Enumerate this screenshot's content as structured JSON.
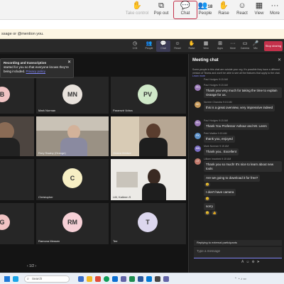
{
  "top_toolbar": {
    "items": [
      {
        "label": "Take control",
        "icon": "hand-icon"
      },
      {
        "label": "Pop out",
        "icon": "popout-icon"
      },
      {
        "label": "Chat",
        "icon": "chat-icon"
      },
      {
        "label": "People",
        "icon": "people-icon",
        "count": "18"
      },
      {
        "label": "Raise",
        "icon": "raise-hand-icon"
      },
      {
        "label": "React",
        "icon": "react-icon"
      },
      {
        "label": "View",
        "icon": "view-icon"
      },
      {
        "label": "More",
        "icon": "more-icon"
      }
    ]
  },
  "banner": {
    "text": "ssage or @mention you."
  },
  "meeting_toolbar": {
    "items": [
      {
        "label": "1:04"
      },
      {
        "label": "People",
        "count": "18"
      },
      {
        "label": "Chat"
      },
      {
        "label": "React"
      },
      {
        "label": "Raise"
      },
      {
        "label": "View"
      },
      {
        "label": "Apps"
      },
      {
        "label": "More"
      },
      {
        "label": "Camera"
      },
      {
        "label": "Mic"
      },
      {
        "label": "Share"
      }
    ],
    "leave_label": "Stop sharing"
  },
  "recording_toast": {
    "title": "Recording and transcription",
    "body": "started for you so that everyone knows they're being included.",
    "link": "Privacy policy"
  },
  "tiles": [
    {
      "initials": "B",
      "name": ""
    },
    {
      "initials": "MN",
      "name": "Mark Norman"
    },
    {
      "initials": "PV",
      "name": "Paramvir Vohra"
    },
    {
      "initials": "",
      "name": ""
    },
    {
      "initials": "",
      "name": "Rory Swaby (Orange)"
    },
    {
      "initials": "",
      "name": "Oriana Ifeldwe"
    },
    {
      "initials": "",
      "name": ""
    },
    {
      "initials": "C",
      "name": "Christopher"
    },
    {
      "initials": "",
      "name": "Lilli, Katleen S"
    },
    {
      "initials": "G",
      "name": ""
    },
    {
      "initials": "RM",
      "name": "Ramona Messen"
    },
    {
      "initials": "T",
      "name": "Tee"
    }
  ],
  "pager": "1/2",
  "chat": {
    "title": "Meeting chat",
    "note": "Some people in this chat are outside your org. It's possible they have a different version of Teams and won't be able to see all the features that apply to the chat.",
    "note_link": "Learn more",
    "messages": [
      {
        "initials": "",
        "meta": "Paul Hodges   9:15 AM",
        "text": ""
      },
      {
        "initials": "PH",
        "meta": "Paul Hodges   9:15 AM",
        "text": "Thank you very much for taking the time to explain Orange for us."
      },
      {
        "initials": "NC",
        "meta": "Noreen Chandra   9:15 AM",
        "text": "this is a great overview, very impressive indeed"
      },
      {
        "initials": "PH",
        "meta": "Paul Hodges   9:15 AM",
        "text": "Thank You Professor Ashour and Mr. Leers"
      },
      {
        "initials": "PK",
        "meta": "Petri Mattke   9:15 AM",
        "text": "thank you, enjoyed"
      },
      {
        "initials": "MN",
        "meta": "Mark Norman   9:15 AM",
        "text": "Thank you.. Excellent"
      },
      {
        "initials": "LT",
        "meta": "Lilliam Imanbek   9:15 AM",
        "text": "Thank you so much! It's nice to learn about new tools"
      },
      {
        "initials": "",
        "meta": "",
        "text": "Are we going to download it for free?"
      },
      {
        "initials": "",
        "meta": "",
        "text": "I don't have camera"
      },
      {
        "initials": "",
        "meta": "",
        "text": "sorry"
      }
    ],
    "reply_label": "Replying to external participants",
    "compose_placeholder": "Type a message"
  },
  "taskbar": {
    "search_placeholder": "Search"
  },
  "colors": {
    "accent": "#7f85f5",
    "danger": "#c4314b",
    "avatar_b": "#f1c4c4",
    "avatar_mn": "#e8e2dc",
    "avatar_pv": "#cfe8c8",
    "avatar_c": "#f7efc4",
    "avatar_g": "#f1c4c4",
    "avatar_rm": "#f6d0d6",
    "avatar_t": "#dcd7ee"
  }
}
